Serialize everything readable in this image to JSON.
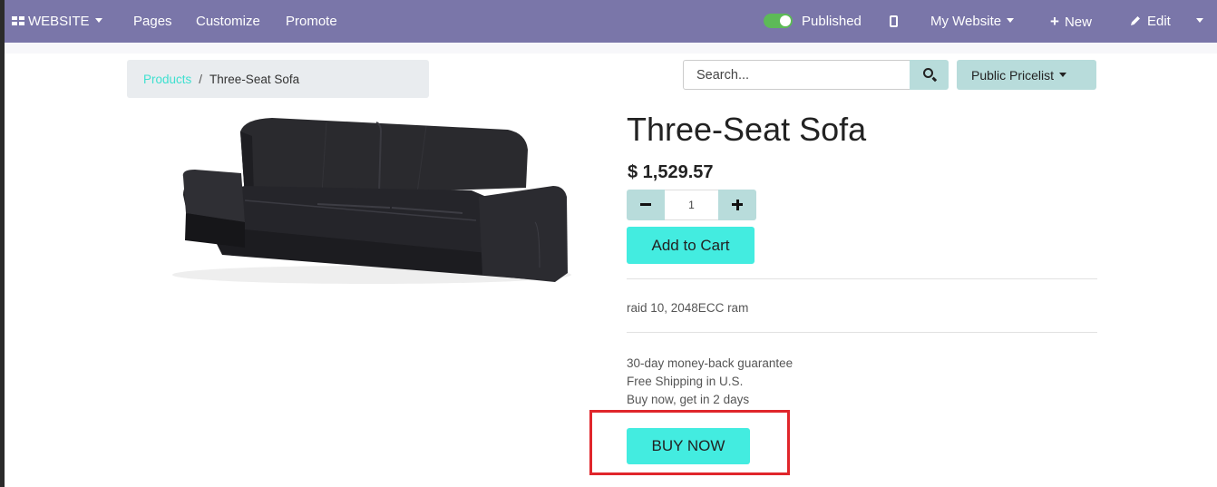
{
  "topbar": {
    "website_label": "WEBSITE",
    "pages": "Pages",
    "customize": "Customize",
    "promote": "Promote",
    "published": "Published",
    "my_website": "My Website",
    "new": "New",
    "edit": "Edit"
  },
  "breadcrumb": {
    "link": "Products",
    "separator": "/",
    "current": "Three-Seat Sofa"
  },
  "search": {
    "placeholder": "Search..."
  },
  "pricelist": {
    "label": "Public Pricelist"
  },
  "product": {
    "title": "Three-Seat Sofa",
    "price": "$ 1,529.57",
    "quantity": "1",
    "add_to_cart": "Add to Cart",
    "description": "raid 10, 2048ECC ram",
    "benefits": [
      "30-day money-back guarantee",
      "Free Shipping in U.S.",
      "Buy now, get in 2 days"
    ],
    "buy_now": "BUY NOW"
  },
  "colors": {
    "topbar": "#7a76a9",
    "accent": "#43ece0",
    "highlight_box": "#e0262b"
  }
}
